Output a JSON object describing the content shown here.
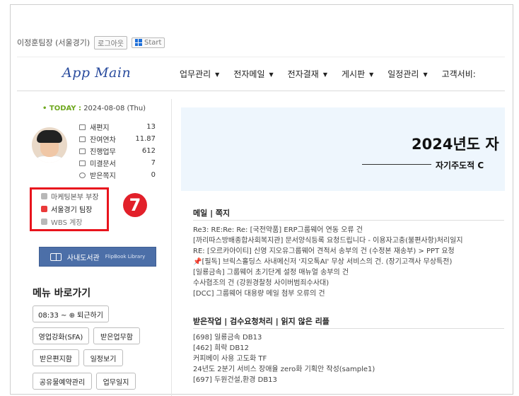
{
  "user": {
    "name": "이정훈팀장 (서울경기)",
    "logout_label": "로그아웃",
    "start_label": "Start"
  },
  "logo": "App Main",
  "nav": [
    "업무관리",
    "전자메일",
    "전자결재",
    "게시판",
    "일정관리",
    "고객서비:"
  ],
  "today": {
    "label": "• TODAY :",
    "date": "2024-08-08 (Thu)"
  },
  "stats": [
    {
      "label": "새편지",
      "value": "13"
    },
    {
      "label": "잔여연차",
      "value": "11.87"
    },
    {
      "label": "진행업무",
      "value": "612"
    },
    {
      "label": "미결문서",
      "value": "7"
    },
    {
      "label": "받은쪽지",
      "value": "0"
    }
  ],
  "departments": [
    "마케팅본부 부장",
    "서울경기 팀장",
    "WBS 계장"
  ],
  "marker": "7",
  "library": {
    "label": "사내도서관",
    "sub": "FlipBook Library"
  },
  "shortcuts": {
    "title": "메뉴 바로가기",
    "items": [
      "08:33 ~ ⊕ 퇴근하기",
      "영업강화(SFA)",
      "받은업무함",
      "받은편지함",
      "일정보기",
      "공유물예약관리",
      "업무일지"
    ]
  },
  "banner": {
    "title": "2024년도 자",
    "subtitle": "자기주도적 C"
  },
  "mail": {
    "title": "메일 | 쪽지",
    "items": [
      "Re3: RE:Re: Re: [국전약품] ERP그룹웨어 연동 오류 건",
      "[까리따스방배종합사회복지관] 문서양식등록 요청드립니다 - 이용자고충(불편사항)처리일지",
      "RE: [오르카아이티] 신영 지오유그룹웨어 견적서 송부의 건 (수정본 재송부) > PPT 요청",
      "📌[필독] 브릭스홀딩스 사내메신저 '지오톡AI' 무상 서비스의 건. (장기고객사 무상특전)",
      "[일룡금속] 그룹웨어 초기단계 설정 매뉴얼 송부의 건",
      "수사협조의 건 (강원경찰청 사이버범죄수사대)",
      "[DCC] 그룹웨어 대용량 메일 첨부 오류의 건"
    ]
  },
  "tasks": {
    "title": "받은작업 | 검수요청처리 | 읽지 않은 리플",
    "items": [
      "[698] 일룡금속 DB13",
      "[462] 희락 DB12",
      "커피베이 사용 고도화 TF",
      "24년도 2분기 서비스 장애율 zero화 기획안 작성(sample1)",
      "[697] 두원건설,환경 DB13"
    ]
  }
}
